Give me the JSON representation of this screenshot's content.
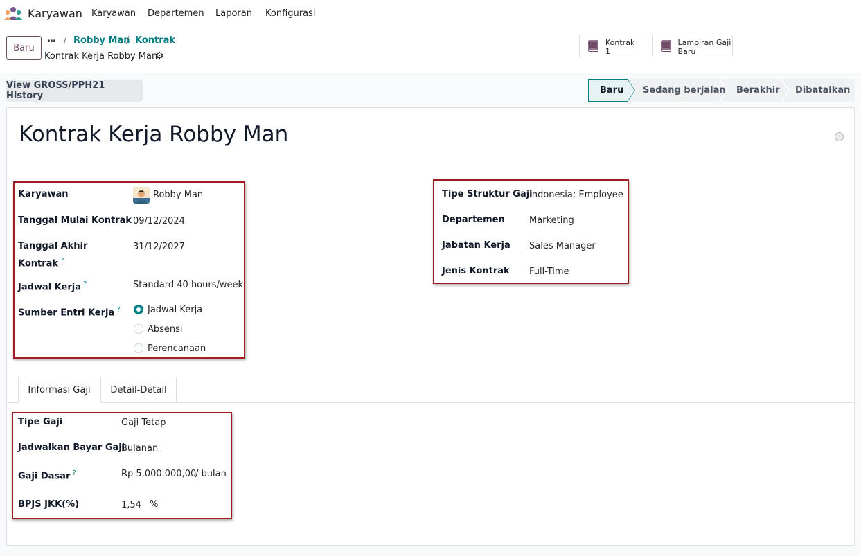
{
  "app": {
    "name": "Karyawan"
  },
  "nav": {
    "items": [
      "Karyawan",
      "Departemen",
      "Laporan",
      "Konfigurasi"
    ]
  },
  "control_panel": {
    "new_label": "Baru",
    "breadcrumb": {
      "dots": "...",
      "links": [
        "Robby Man",
        "Kontrak"
      ],
      "current": "Kontrak Kerja Robby Man"
    }
  },
  "smart_buttons": [
    {
      "label": "Kontrak",
      "value": "1",
      "icon": "book-icon"
    },
    {
      "label": "Lampiran Gaji",
      "value": "Baru",
      "icon": "book-icon"
    }
  ],
  "history_button": "View GROSS/PPH21 History",
  "status": {
    "stages": [
      "Baru",
      "Sedang berjalan",
      "Berakhir",
      "Dibatalkan"
    ],
    "active": "Baru",
    "accent": "#017e84"
  },
  "record": {
    "title": "Kontrak Kerja Robby Man",
    "left_fields": {
      "employee_label": "Karyawan",
      "employee": "Robby Man",
      "start_label": "Tanggal Mulai Kontrak",
      "start": "09/12/2024",
      "end_label_1": "Tanggal Akhir",
      "end_label_2": "Kontrak",
      "end": "31/12/2027",
      "schedule_label": "Jadwal Kerja",
      "schedule": "Standard 40 hours/week",
      "source_label": "Sumber Entri Kerja",
      "source_options": [
        "Jadwal Kerja",
        "Absensi",
        "Perencanaan"
      ],
      "source_selected": "Jadwal Kerja"
    },
    "right_fields": {
      "structure_label": "Tipe Struktur Gaji",
      "structure": "Indonesia: Employee",
      "department_label": "Departemen",
      "department": "Marketing",
      "job_label": "Jabatan Kerja",
      "job": "Sales Manager",
      "contract_type_label": "Jenis Kontrak",
      "contract_type": "Full-Time"
    }
  },
  "tabs": {
    "items": [
      "Informasi Gaji",
      "Detail-Detail"
    ],
    "active": "Informasi Gaji"
  },
  "salary": {
    "wage_type_label": "Tipe Gaji",
    "wage_type": "Gaji Tetap",
    "pay_schedule_label": "Jadwalkan Bayar Gaji",
    "pay_schedule": "Bulanan",
    "wage_label": "Gaji Dasar",
    "wage": "Rp 5.000.000,00",
    "wage_unit": "/ bulan",
    "jkk_label": "BPJS JKK(%)",
    "jkk": "1,54",
    "jkk_unit": "%"
  },
  "help_mark": "?",
  "gear_icon": "⚙"
}
